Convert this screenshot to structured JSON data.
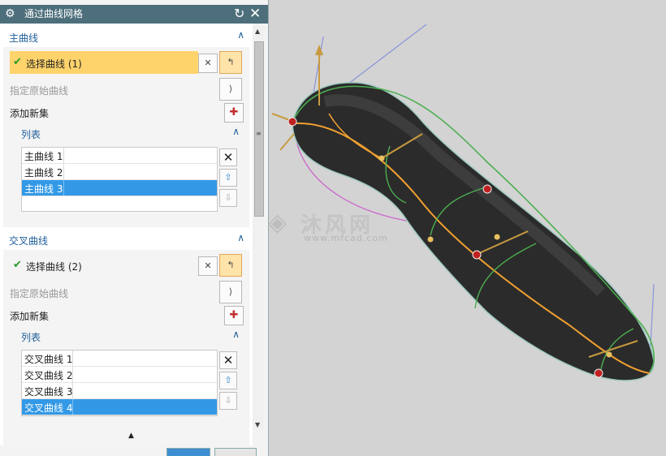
{
  "window": {
    "title": "通过曲线网格",
    "gear_icon": "⚙",
    "reset_icon": "↻",
    "close_icon": "✕"
  },
  "primary": {
    "header": "主曲线",
    "select_label": "选择曲线 (1)",
    "specify_origin": "指定原始曲线",
    "add_new_set": "添加新集",
    "list_header": "列表",
    "items": [
      "主曲线 1",
      "主曲线 2",
      "主曲线 3"
    ],
    "selected_index": 2
  },
  "cross": {
    "header": "交叉曲线",
    "select_label": "选择曲线 (2)",
    "specify_origin": "指定原始曲线",
    "add_new_set": "添加新集",
    "list_header": "列表",
    "items": [
      "交叉曲线 1",
      "交叉曲线 2",
      "交叉曲线 3",
      "交叉曲线 4"
    ],
    "selected_index": 3
  },
  "icons": {
    "check": "✔",
    "caret_up": "∧",
    "remove": "✕",
    "move_up": "⇧",
    "move_down": "⇩",
    "add": "✚",
    "select_point": "✕",
    "curve_rule": "↰",
    "origin_curve": "⟩",
    "collapse": "▲",
    "scroll_up": "▲",
    "scroll_down": "▼",
    "scroll_grip": "≡"
  },
  "watermark": {
    "logo": "◈",
    "name": "沐风网",
    "url": "www.mfcad.com"
  },
  "colors": {
    "titlebar": "#4d6f7c",
    "section_header": "#1f5f9a",
    "selection_highlight": "#ffd36b",
    "list_selection": "#3399e6",
    "shape_body": "#2b2b2b",
    "curve_orange": "#f0a030",
    "curve_green": "#4caf50",
    "curve_magenta": "#cc66cc",
    "axis_blue": "#6a7fd0"
  }
}
